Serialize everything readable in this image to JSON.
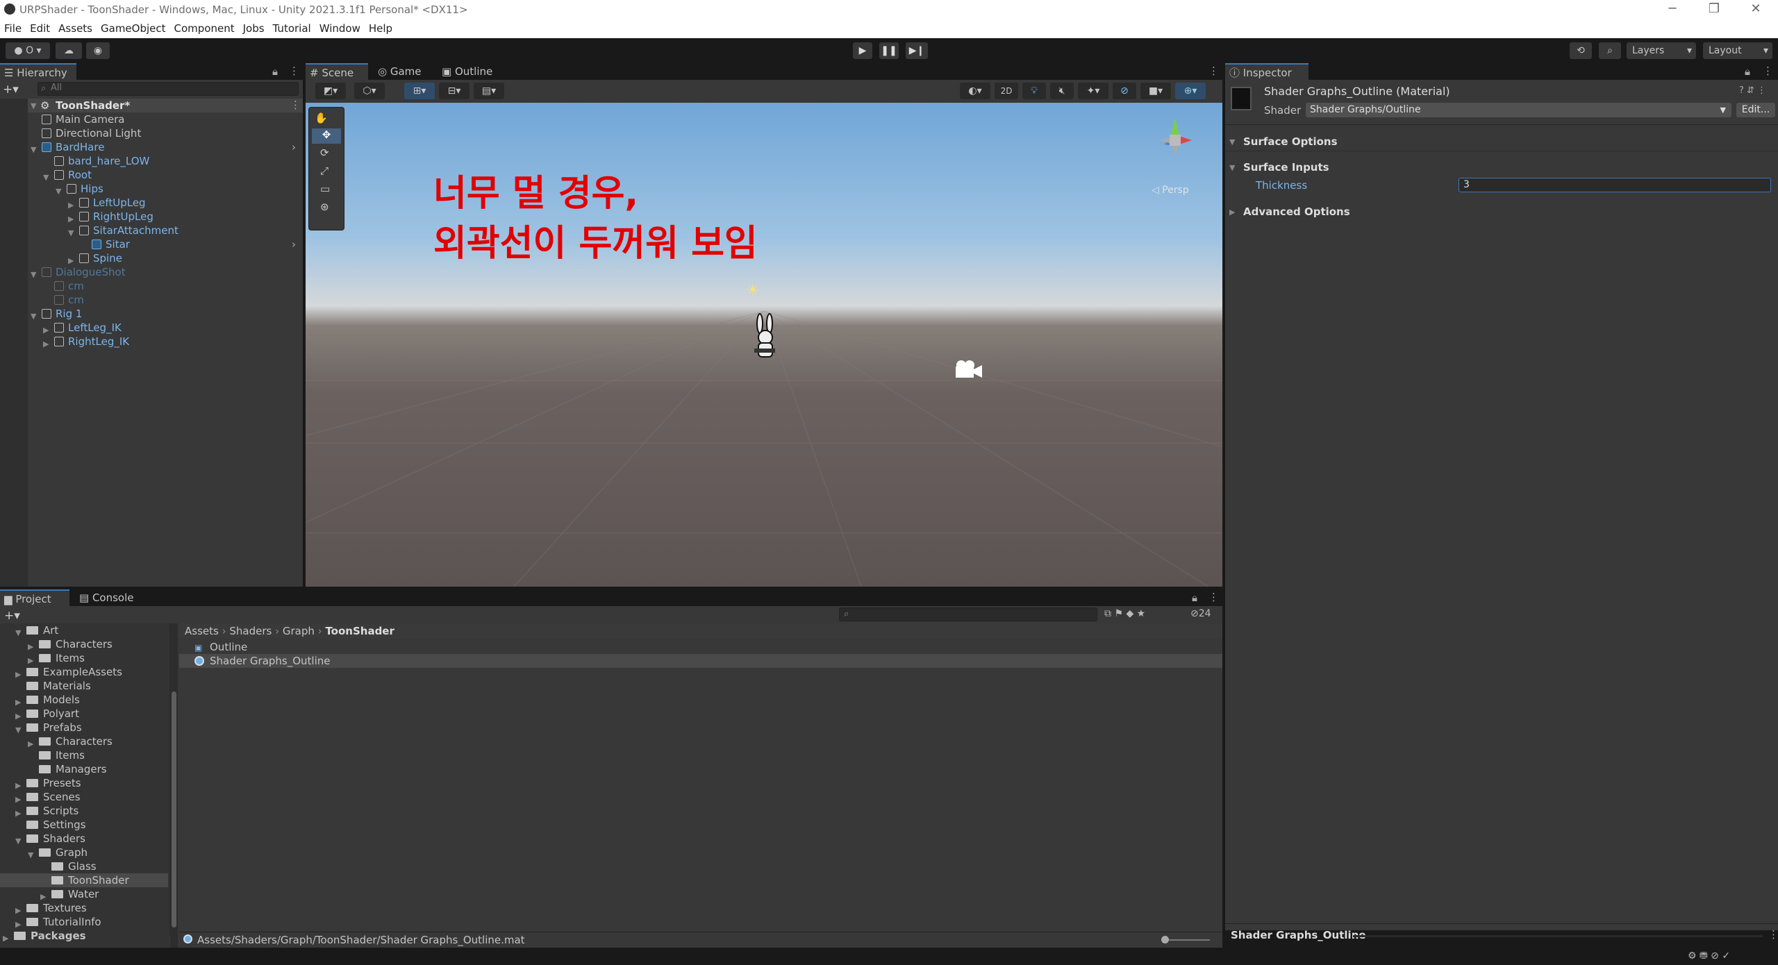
{
  "window": {
    "title": "URPShader - ToonShader - Windows, Mac, Linux - Unity 2021.3.1f1 Personal* <DX11>",
    "minimize": "─",
    "restore": "❐",
    "close": "✕"
  },
  "menu": [
    "File",
    "Edit",
    "Assets",
    "GameObject",
    "Component",
    "Jobs",
    "Tutorial",
    "Window",
    "Help"
  ],
  "toolbar": {
    "account": "● O ▾",
    "layers": "Layers",
    "layout": "Layout",
    "play": "▶",
    "pause": "❚❚",
    "step": "▶❙"
  },
  "hierarchy": {
    "tab": "Hierarchy",
    "search_placeholder": "All",
    "scene_name": "ToonShader*",
    "items": [
      {
        "label": "Main Camera",
        "depth": 1,
        "style": "normal"
      },
      {
        "label": "Directional Light",
        "depth": 1,
        "style": "normal"
      },
      {
        "label": "BardHare",
        "depth": 1,
        "style": "prefab",
        "expanded": true
      },
      {
        "label": "bard_hare_LOW",
        "depth": 2,
        "style": "prefab-child"
      },
      {
        "label": "Root",
        "depth": 2,
        "style": "prefab-child",
        "expanded": true
      },
      {
        "label": "Hips",
        "depth": 3,
        "style": "prefab-child",
        "expanded": true
      },
      {
        "label": "LeftUpLeg",
        "depth": 4,
        "style": "prefab-child",
        "expanded": false
      },
      {
        "label": "RightUpLeg",
        "depth": 4,
        "style": "prefab-child",
        "expanded": false
      },
      {
        "label": "SitarAttachment",
        "depth": 4,
        "style": "prefab-child",
        "expanded": true
      },
      {
        "label": "Sitar",
        "depth": 5,
        "style": "prefab"
      },
      {
        "label": "Spine",
        "depth": 4,
        "style": "prefab-child",
        "expanded": false
      },
      {
        "label": "DialogueShot",
        "depth": 1,
        "style": "disabled",
        "expanded": true
      },
      {
        "label": "cm",
        "depth": 2,
        "style": "disabled"
      },
      {
        "label": "cm",
        "depth": 2,
        "style": "disabled"
      },
      {
        "label": "Rig 1",
        "depth": 1,
        "style": "prefab-child",
        "expanded": true
      },
      {
        "label": "LeftLeg_IK",
        "depth": 2,
        "style": "prefab-child",
        "expanded": false
      },
      {
        "label": "RightLeg_IK",
        "depth": 2,
        "style": "prefab-child",
        "expanded": false
      }
    ]
  },
  "scene_tabs": [
    "Scene",
    "Game",
    "Outline"
  ],
  "scene": {
    "overlay_line1": "너무 멀 경우,",
    "overlay_line2": "외곽선이 두꺼워 보임",
    "persp": "◁ Persp",
    "btn_2d": "2D"
  },
  "inspector": {
    "tab": "Inspector",
    "material_name": "Shader Graphs_Outline (Material)",
    "shader_label": "Shader",
    "shader_value": "Shader Graphs/Outline",
    "edit_button": "Edit...",
    "sections": {
      "surface_options": "Surface Options",
      "surface_inputs": "Surface Inputs",
      "advanced": "Advanced Options"
    },
    "thickness_label": "Thickness",
    "thickness_value": "3",
    "footer": "Shader Graphs_Outline"
  },
  "project": {
    "tabs": [
      "Project",
      "Console"
    ],
    "hidden_count": "24",
    "folders": [
      {
        "label": "Art",
        "depth": 1,
        "expanded": true
      },
      {
        "label": "Characters",
        "depth": 2,
        "expanded": false
      },
      {
        "label": "Items",
        "depth": 2,
        "expanded": false
      },
      {
        "label": "ExampleAssets",
        "depth": 1,
        "expanded": false
      },
      {
        "label": "Materials",
        "depth": 1,
        "expanded": null
      },
      {
        "label": "Models",
        "depth": 1,
        "expanded": false
      },
      {
        "label": "Polyart",
        "depth": 1,
        "expanded": false
      },
      {
        "label": "Prefabs",
        "depth": 1,
        "expanded": true
      },
      {
        "label": "Characters",
        "depth": 2,
        "expanded": false
      },
      {
        "label": "Items",
        "depth": 2,
        "expanded": null
      },
      {
        "label": "Managers",
        "depth": 2,
        "expanded": null
      },
      {
        "label": "Presets",
        "depth": 1,
        "expanded": false
      },
      {
        "label": "Scenes",
        "depth": 1,
        "expanded": false
      },
      {
        "label": "Scripts",
        "depth": 1,
        "expanded": false
      },
      {
        "label": "Settings",
        "depth": 1,
        "expanded": null
      },
      {
        "label": "Shaders",
        "depth": 1,
        "expanded": true
      },
      {
        "label": "Graph",
        "depth": 2,
        "expanded": true
      },
      {
        "label": "Glass",
        "depth": 3,
        "expanded": null
      },
      {
        "label": "ToonShader",
        "depth": 3,
        "expanded": null,
        "selected": true
      },
      {
        "label": "Water",
        "depth": 3,
        "expanded": false
      },
      {
        "label": "Textures",
        "depth": 1,
        "expanded": false
      },
      {
        "label": "TutorialInfo",
        "depth": 1,
        "expanded": false
      },
      {
        "label": "Packages",
        "depth": 0,
        "expanded": false
      }
    ],
    "breadcrumb": [
      "Assets",
      "Shaders",
      "Graph",
      "ToonShader"
    ],
    "files": [
      {
        "label": "Outline",
        "kind": "shadergraph"
      },
      {
        "label": "Shader Graphs_Outline",
        "kind": "material",
        "selected": true
      }
    ],
    "path": "Assets/Shaders/Graph/ToonShader/Shader Graphs_Outline.mat"
  }
}
